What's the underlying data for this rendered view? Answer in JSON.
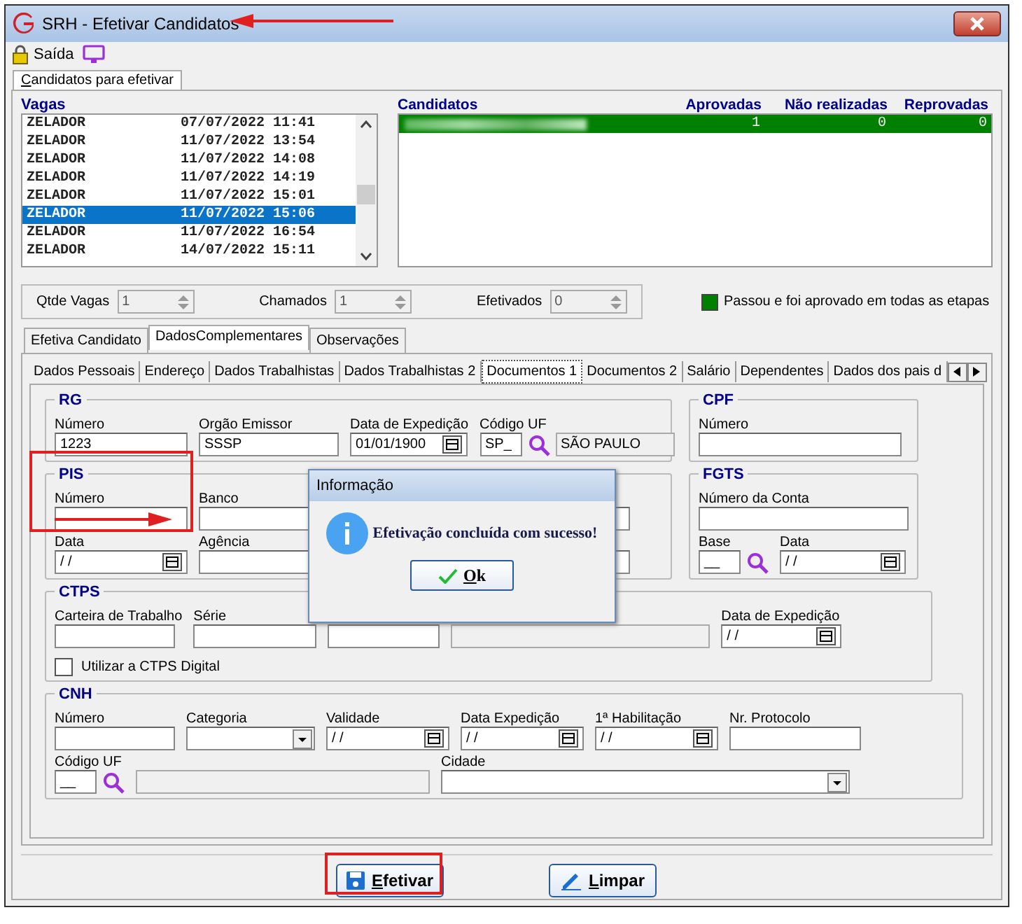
{
  "window": {
    "title": "SRH - Efetivar Candidatos"
  },
  "toolbar": [
    {
      "kind": "exit",
      "label": "Saída"
    },
    {
      "kind": "monitor"
    }
  ],
  "main_tabs": [
    {
      "label": "Candidatos para efetivar",
      "selected": true
    }
  ],
  "vagas": {
    "title": "Vagas",
    "rows": [
      {
        "name": "ZELADOR",
        "date": "07/07/2022 11:41",
        "selected": false
      },
      {
        "name": "ZELADOR",
        "date": "11/07/2022 13:54",
        "selected": false
      },
      {
        "name": "ZELADOR",
        "date": "11/07/2022 14:08",
        "selected": false
      },
      {
        "name": "ZELADOR",
        "date": "11/07/2022 14:19",
        "selected": false
      },
      {
        "name": "ZELADOR",
        "date": "11/07/2022 15:01",
        "selected": false
      },
      {
        "name": "ZELADOR",
        "date": "11/07/2022 15:06",
        "selected": true
      },
      {
        "name": "ZELADOR",
        "date": "11/07/2022 16:54",
        "selected": false
      },
      {
        "name": "ZELADOR",
        "date": "14/07/2022 15:11",
        "selected": false
      }
    ]
  },
  "candidatos": {
    "columns": [
      "Candidatos",
      "Aprovadas",
      "Não realizadas",
      "Reprovadas"
    ],
    "rows": [
      {
        "aprovadas": "1",
        "nao_realizadas": "0",
        "reprovadas": "0",
        "color": "#008000"
      }
    ]
  },
  "counters": [
    {
      "label": "Qtde Vagas",
      "value": "1"
    },
    {
      "label": "Chamados",
      "value": "1"
    },
    {
      "label": "Efetivados",
      "value": "0"
    }
  ],
  "legend": [
    {
      "color": "#008000",
      "label": "Passou e foi aprovado em todas as etapas"
    }
  ],
  "tabs": [
    {
      "label": "Efetiva Candidato",
      "selected": false
    },
    {
      "label": "DadosComplementares",
      "selected": true
    },
    {
      "label": "Observações",
      "selected": false
    }
  ],
  "sub_tabs": [
    {
      "label": "Dados Pessoais",
      "selected": false
    },
    {
      "label": "Endereço",
      "selected": false
    },
    {
      "label": "Dados Trabalhistas",
      "selected": false
    },
    {
      "label": "Dados Trabalhistas 2",
      "selected": false
    },
    {
      "label": "Documentos 1",
      "selected": true
    },
    {
      "label": "Documentos 2",
      "selected": false
    },
    {
      "label": "Salário",
      "selected": false
    },
    {
      "label": "Dependentes",
      "selected": false
    },
    {
      "label": "Dados dos pais d",
      "selected": false
    }
  ],
  "groups": [
    {
      "title": "RG",
      "rows": [
        [
          {
            "kind": "text",
            "label": "Número",
            "value": "1223"
          },
          {
            "kind": "text",
            "label": "Orgão Emissor",
            "value": "SSSP"
          },
          {
            "kind": "date",
            "label": "Data de Expedição",
            "value": "01/01/1900"
          },
          {
            "kind": "lookup",
            "label": "Código UF",
            "value": "SP_",
            "description": "SÃO PAULO"
          }
        ]
      ]
    },
    {
      "title": "CPF",
      "rows": [
        [
          {
            "kind": "text",
            "label": "Número"
          }
        ]
      ]
    },
    {
      "title": "PIS",
      "rows": [
        [
          {
            "kind": "text",
            "label": "Número"
          },
          {
            "kind": "text",
            "label": "Banco"
          },
          {
            "kind": "text"
          }
        ],
        [
          {
            "kind": "date",
            "label": "Data",
            "value": "/ /"
          },
          {
            "kind": "text",
            "label": "Agência"
          },
          {
            "kind": "text"
          }
        ]
      ]
    },
    {
      "title": "FGTS",
      "rows": [
        [
          {
            "kind": "text",
            "label": "Número da Conta"
          }
        ],
        [
          {
            "kind": "lookup",
            "label": "Base",
            "value": "__"
          },
          {
            "kind": "date",
            "label": "Data",
            "value": "/ /"
          }
        ]
      ]
    },
    {
      "title": "CTPS",
      "rows": [
        [
          {
            "kind": "text",
            "label": "Carteira de Trabalho"
          },
          {
            "kind": "text",
            "label": "Série"
          },
          {
            "kind": "text"
          },
          {
            "kind": "disabled"
          },
          {
            "kind": "date",
            "label": "Data de Expedição",
            "value": "/ /"
          }
        ],
        [
          {
            "kind": "checkbox",
            "label": "Utilizar a CTPS Digital",
            "checked": false
          }
        ]
      ]
    },
    {
      "title": "CNH",
      "rows": [
        [
          {
            "kind": "text",
            "label": "Número"
          },
          {
            "kind": "combo",
            "label": "Categoria"
          },
          {
            "kind": "date",
            "label": "Validade",
            "value": "/ /"
          },
          {
            "kind": "date",
            "label": "Data Expedição",
            "value": "/ /"
          },
          {
            "kind": "date",
            "label": "1ª Habilitação",
            "value": "/ /"
          },
          {
            "kind": "text",
            "label": "Nr. Protocolo"
          }
        ],
        [
          {
            "kind": "lookup",
            "label": "Código UF",
            "value": "__"
          },
          {
            "kind": "disabled"
          },
          {
            "kind": "combo",
            "label": "Cidade"
          }
        ]
      ]
    }
  ],
  "dialog": {
    "title": "Informação",
    "message": "Efetivação concluída com sucesso!",
    "button": "Ok"
  },
  "buttons": [
    {
      "kind": "save",
      "label": "Efetivar"
    },
    {
      "kind": "edit",
      "label": "Limpar"
    }
  ],
  "annotations": [
    {
      "kind": "arrow"
    },
    {
      "kind": "frame"
    },
    {
      "kind": "arrow"
    },
    {
      "kind": "frame"
    }
  ]
}
